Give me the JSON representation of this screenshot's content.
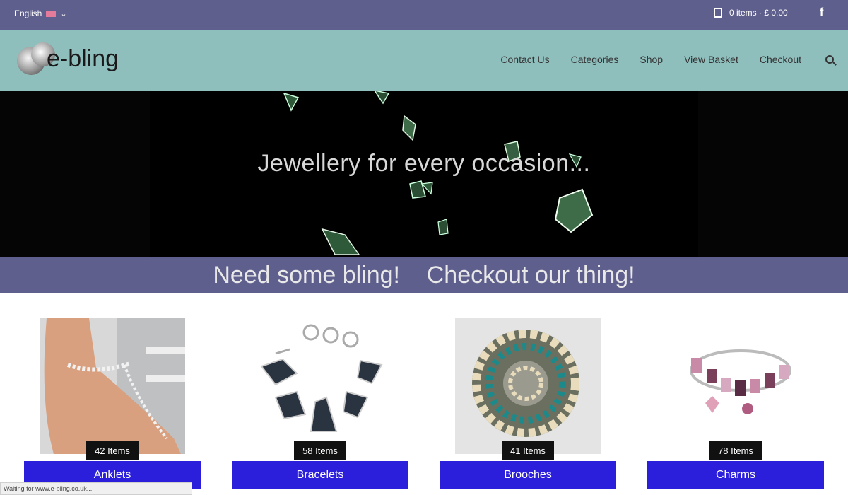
{
  "topbar": {
    "language": "English",
    "cart_text": "0 items · £ 0.00"
  },
  "header": {
    "logo_text": "e-bling",
    "nav": [
      "Contact Us",
      "Categories",
      "Shop",
      "View Basket",
      "Checkout"
    ]
  },
  "hero": {
    "title": "Jewellery for every occasion..."
  },
  "banner": {
    "text": "Need some bling!    Checkout our thing!"
  },
  "categories": [
    {
      "name": "Anklets",
      "count": "42 Items"
    },
    {
      "name": "Bracelets",
      "count": "58 Items"
    },
    {
      "name": "Brooches",
      "count": "41 Items"
    },
    {
      "name": "Charms",
      "count": "78 Items"
    }
  ],
  "status_bar": {
    "text": "Waiting for www.e-bling.co.uk..."
  },
  "colors": {
    "topbar": "#5f5f8e",
    "header": "#8fbfbd",
    "button": "#2b1fdc"
  }
}
